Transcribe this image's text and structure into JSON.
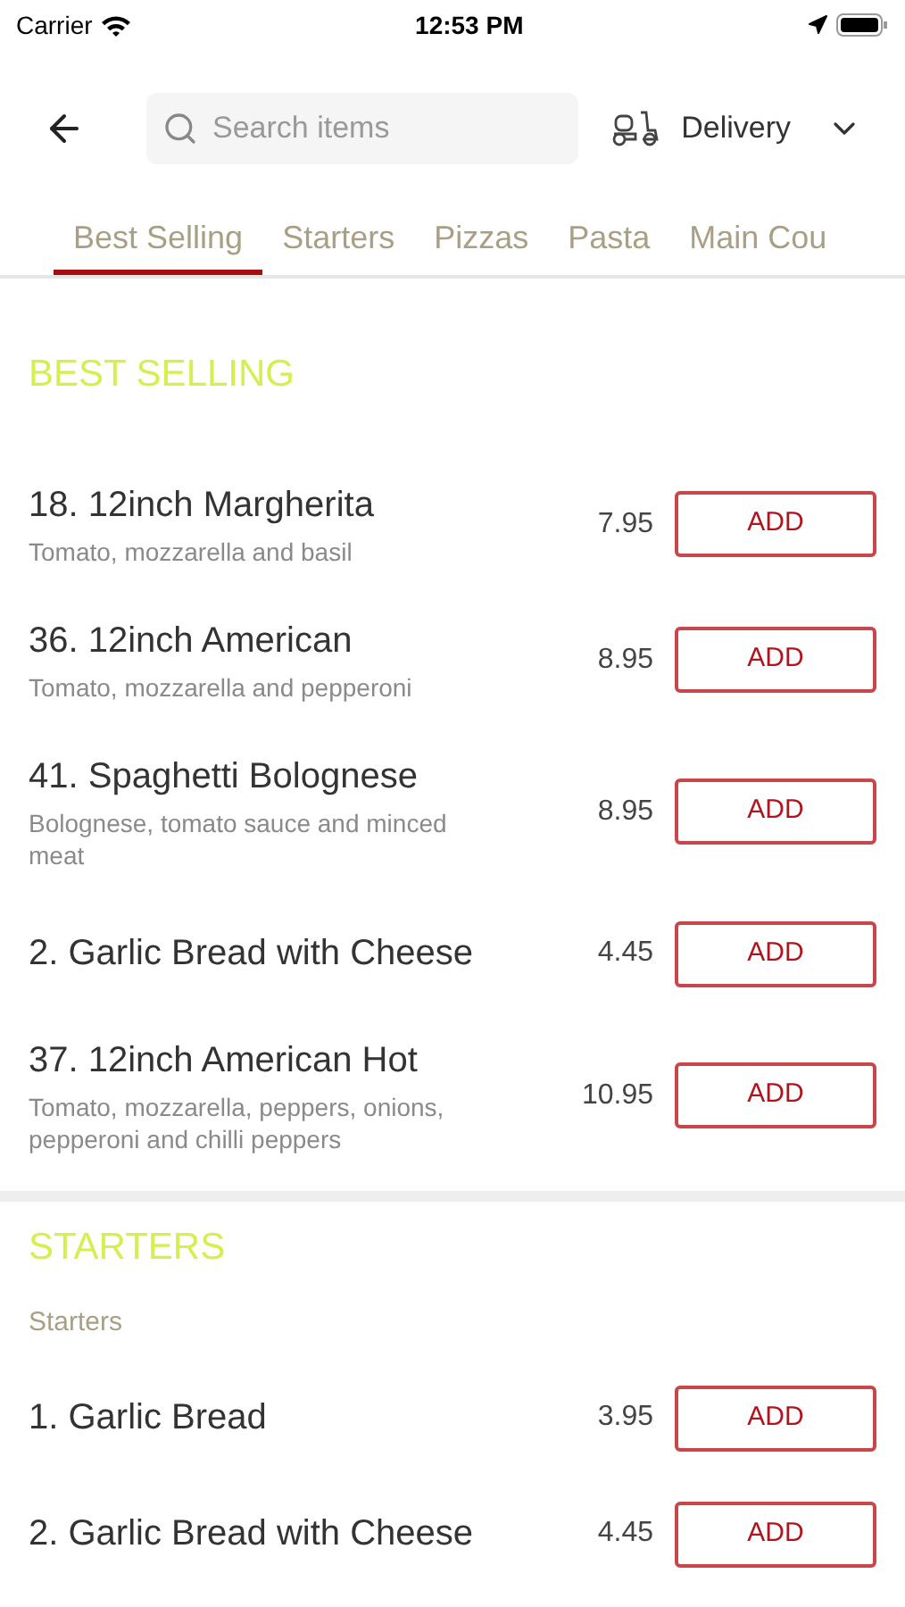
{
  "status_bar": {
    "carrier": "Carrier",
    "time": "12:53 PM"
  },
  "header": {
    "search": {
      "placeholder": "Search items"
    },
    "order_type": "Delivery"
  },
  "tabs": [
    {
      "label": "Best Selling",
      "selected": true
    },
    {
      "label": "Starters",
      "selected": false
    },
    {
      "label": "Pizzas",
      "selected": false
    },
    {
      "label": "Pasta",
      "selected": false
    },
    {
      "label": "Main Cou",
      "selected": false
    }
  ],
  "sections": [
    {
      "title": "BEST SELLING",
      "items": [
        {
          "name": "18. 12inch Margherita",
          "description": "Tomato, mozzarella and basil",
          "price": "7.95",
          "button": "ADD"
        },
        {
          "name": "36. 12inch American",
          "description": "Tomato, mozzarella and pepperoni",
          "price": "8.95",
          "button": "ADD"
        },
        {
          "name": "41. Spaghetti Bolognese",
          "description": "Bolognese, tomato sauce and minced meat",
          "price": "8.95",
          "button": "ADD"
        },
        {
          "name": "2. Garlic Bread with Cheese",
          "price": "4.45",
          "button": "ADD"
        },
        {
          "name": "37. 12inch American Hot",
          "description": "Tomato, mozzarella, peppers, onions, pepperoni and chilli peppers",
          "price": "10.95",
          "button": "ADD"
        }
      ]
    },
    {
      "title": "STARTERS",
      "subtitle": "Starters",
      "items": [
        {
          "name": "1. Garlic Bread",
          "price": "3.95",
          "button": "ADD"
        },
        {
          "name": "2. Garlic Bread with Cheese",
          "price": "4.45",
          "button": "ADD"
        }
      ]
    }
  ]
}
